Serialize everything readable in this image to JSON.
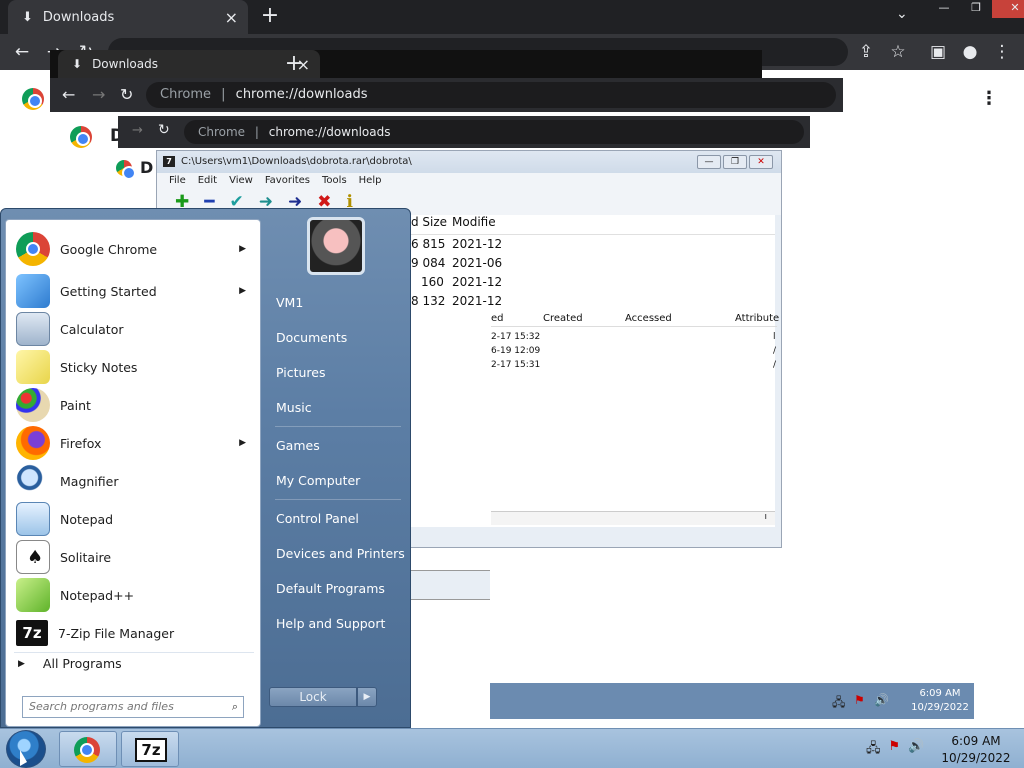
{
  "chrome": {
    "tab_title": "Downloads",
    "tab_close": "×",
    "new_tab": "+",
    "tab_search": "⌄",
    "win_min": "—",
    "win_max": "❐",
    "win_close": "✕",
    "back": "←",
    "forward": "→",
    "reload": "↻",
    "page_letter": "D",
    "menu": "⋮",
    "share": "⇪",
    "bookmark": "☆",
    "sidepanel": "▣",
    "profile": "●"
  },
  "ghost_chrome_1": {
    "tab_title": "Downloads",
    "omnibox_chip": "Chrome",
    "omnibox_sep": "|",
    "omnibox_url": "chrome://downloads"
  },
  "ghost_chrome_2": {
    "omnibox_chip": "Chrome",
    "omnibox_sep": "|",
    "omnibox_url": "chrome://downloads"
  },
  "sevenzip": {
    "title": "C:\\Users\\vm1\\Downloads\\dobrota.rar\\dobrota\\",
    "menu": [
      "File",
      "Edit",
      "View",
      "Favorites",
      "Tools",
      "Help"
    ],
    "toolbar_icons": [
      "add-icon",
      "remove-icon",
      "extract-icon",
      "test-icon",
      "copy-icon",
      "delete-icon",
      "info-icon"
    ],
    "toolbar_glyphs": [
      "✚",
      "━",
      "✔",
      "➜",
      "➜",
      "✖",
      "ℹ"
    ],
    "columns": [
      "d Size",
      "Modifie"
    ],
    "rows": [
      {
        "size": "6 815",
        "modified": "2021-12"
      },
      {
        "size": "9 084",
        "modified": "2021-06"
      },
      {
        "size": "160",
        "modified": "2021-12"
      },
      {
        "size": "8 132",
        "modified": "2021-12"
      }
    ],
    "sub_columns": [
      "ed",
      "Created",
      "Accessed",
      "Attribute"
    ],
    "sub_rows": [
      "2-17 15:32",
      "6-19 12:09",
      "2-17 15:31"
    ],
    "sub_attr_marks": [
      "l",
      "/",
      "/"
    ],
    "scroll_mark": "ı"
  },
  "start_menu": {
    "programs": [
      {
        "label": "Google Chrome",
        "has_submenu": true
      },
      {
        "label": "Getting Started",
        "has_submenu": true
      },
      {
        "label": "Calculator",
        "has_submenu": false
      },
      {
        "label": "Sticky Notes",
        "has_submenu": false
      },
      {
        "label": "Paint",
        "has_submenu": false
      },
      {
        "label": "Firefox",
        "has_submenu": true
      },
      {
        "label": "Magnifier",
        "has_submenu": false
      },
      {
        "label": "Notepad",
        "has_submenu": false
      },
      {
        "label": "Solitaire",
        "has_submenu": false
      },
      {
        "label": "Notepad++",
        "has_submenu": false
      },
      {
        "label": "7-Zip File Manager",
        "has_submenu": false
      }
    ],
    "all_programs": "All Programs",
    "all_programs_arrow": "▶",
    "submenu_arrow": "▶",
    "search_placeholder": "Search programs and files",
    "search_glyph": "⌕",
    "right_items": [
      "VM1",
      "Documents",
      "Pictures",
      "Music",
      "Games",
      "My Computer",
      "Control Panel",
      "Devices and Printers",
      "Default Programs",
      "Help and Support"
    ],
    "lock_label": "Lock",
    "lock_arrow": "▶"
  },
  "taskbar": {
    "time": "6:09 AM",
    "date": "10/29/2022",
    "tray_icons": [
      "network-icon",
      "action-center-icon",
      "volume-icon"
    ],
    "tray_glyphs": [
      "🖧",
      "⚑",
      "🔊"
    ],
    "sevenzip_label": "7z"
  },
  "ghost_taskbar": {
    "time": "6:09 AM",
    "date": "10/29/2022"
  }
}
